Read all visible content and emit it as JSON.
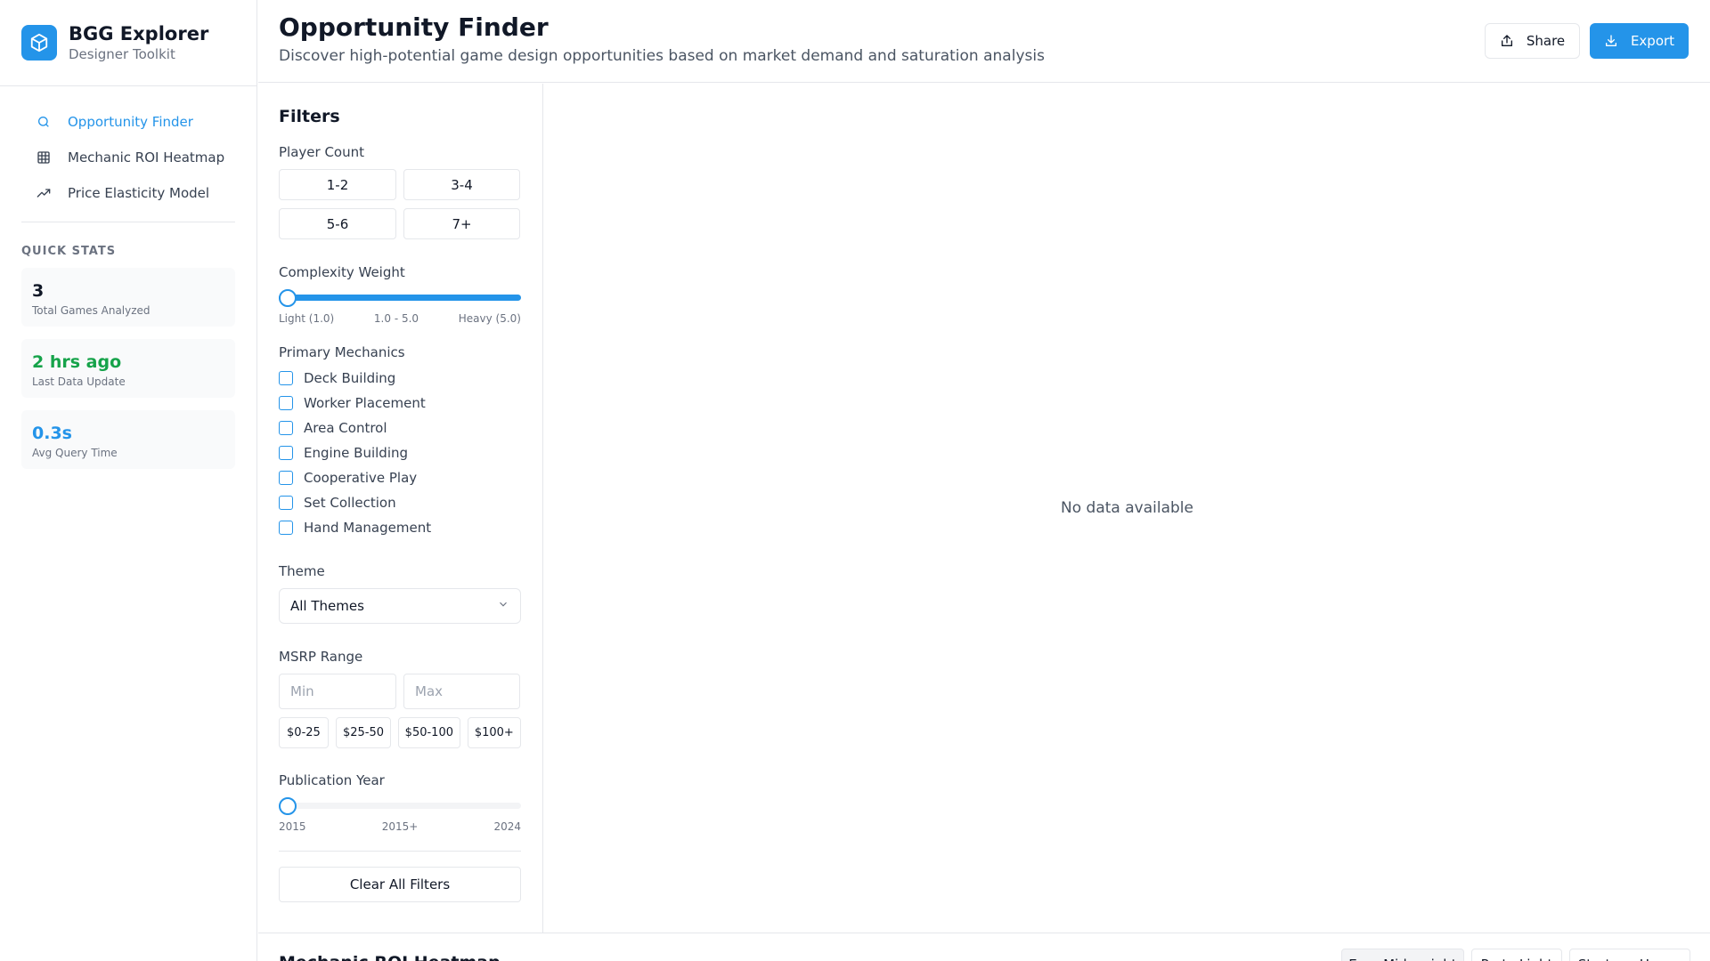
{
  "brand": {
    "title": "BGG Explorer",
    "subtitle": "Designer Toolkit",
    "icon": "cube-icon"
  },
  "nav": {
    "items": [
      {
        "label": "Opportunity Finder",
        "icon": "search-icon",
        "active": true
      },
      {
        "label": "Mechanic ROI Heatmap",
        "icon": "grid-icon",
        "active": false
      },
      {
        "label": "Price Elasticity Model",
        "icon": "trending-up-icon",
        "active": false
      }
    ]
  },
  "quick_stats": {
    "title": "QUICK STATS",
    "cards": [
      {
        "value": "3",
        "label": "Total Games Analyzed",
        "color": "#111827"
      },
      {
        "value": "2 hrs ago",
        "label": "Last Data Update",
        "color": "#16a34a"
      },
      {
        "value": "0.3s",
        "label": "Avg Query Time",
        "color": "#2494e9"
      }
    ]
  },
  "header": {
    "title": "Opportunity Finder",
    "subtitle": "Discover high-potential game design opportunities based on market demand and saturation analysis",
    "share_label": "Share",
    "export_label": "Export"
  },
  "filters": {
    "title": "Filters",
    "player_count": {
      "label": "Player Count",
      "options": [
        "1-2",
        "3-4",
        "5-6",
        "7+"
      ]
    },
    "complexity": {
      "label": "Complexity Weight",
      "min_label": "Light (1.0)",
      "range_label": "1.0 - 5.0",
      "max_label": "Heavy (5.0)",
      "min": 1.0,
      "max": 5.0,
      "selected_min": 1.0,
      "selected_max": 5.0
    },
    "mechanics": {
      "label": "Primary Mechanics",
      "options": [
        "Deck Building",
        "Worker Placement",
        "Area Control",
        "Engine Building",
        "Cooperative Play",
        "Set Collection",
        "Hand Management"
      ]
    },
    "theme": {
      "label": "Theme",
      "selected": "All Themes"
    },
    "msrp": {
      "label": "MSRP Range",
      "min_placeholder": "Min",
      "max_placeholder": "Max",
      "presets": [
        "$0-25",
        "$25-50",
        "$50-100",
        "$100+"
      ]
    },
    "year": {
      "label": "Publication Year",
      "min_label": "2015",
      "range_label": "2015+",
      "max_label": "2024",
      "selected_from": 2015
    },
    "clear_label": "Clear All Filters"
  },
  "main": {
    "empty_text": "No data available"
  },
  "heatmap": {
    "title": "Mechanic ROI Heatmap",
    "segments": [
      {
        "label": "Euro Mid-weight",
        "active": true
      },
      {
        "label": "Party Light",
        "active": false
      },
      {
        "label": "Strategy Heavy",
        "active": false
      }
    ]
  },
  "colors": {
    "accent": "#2494e9",
    "success": "#16a34a",
    "border": "#e5e7eb"
  }
}
